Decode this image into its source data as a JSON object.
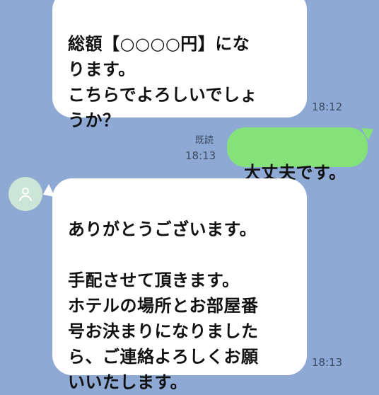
{
  "messages": {
    "msg1": {
      "text": "総額【○○○○円】にな\nります。\nこちらでよろしいでしょ\nうか？",
      "time": "18:12"
    },
    "msg2": {
      "text": "大丈夫です。",
      "read": "既読",
      "time": "18:13"
    },
    "msg3": {
      "text": "ありがとうございます。\n\n手配させて頂きます。\nホテルの場所とお部屋番\n号お決まりになりました\nら、ご連絡よろしくお願\nいいたします。",
      "time": "18:13"
    }
  },
  "colors": {
    "background": "#8DA9D4",
    "incoming_bubble": "#FFFFFF",
    "outgoing_bubble": "#85E27A",
    "avatar_bg": "#CBE6D7",
    "avatar_icon": "#FFFFFF"
  },
  "icons": {
    "avatar": "user-icon"
  }
}
